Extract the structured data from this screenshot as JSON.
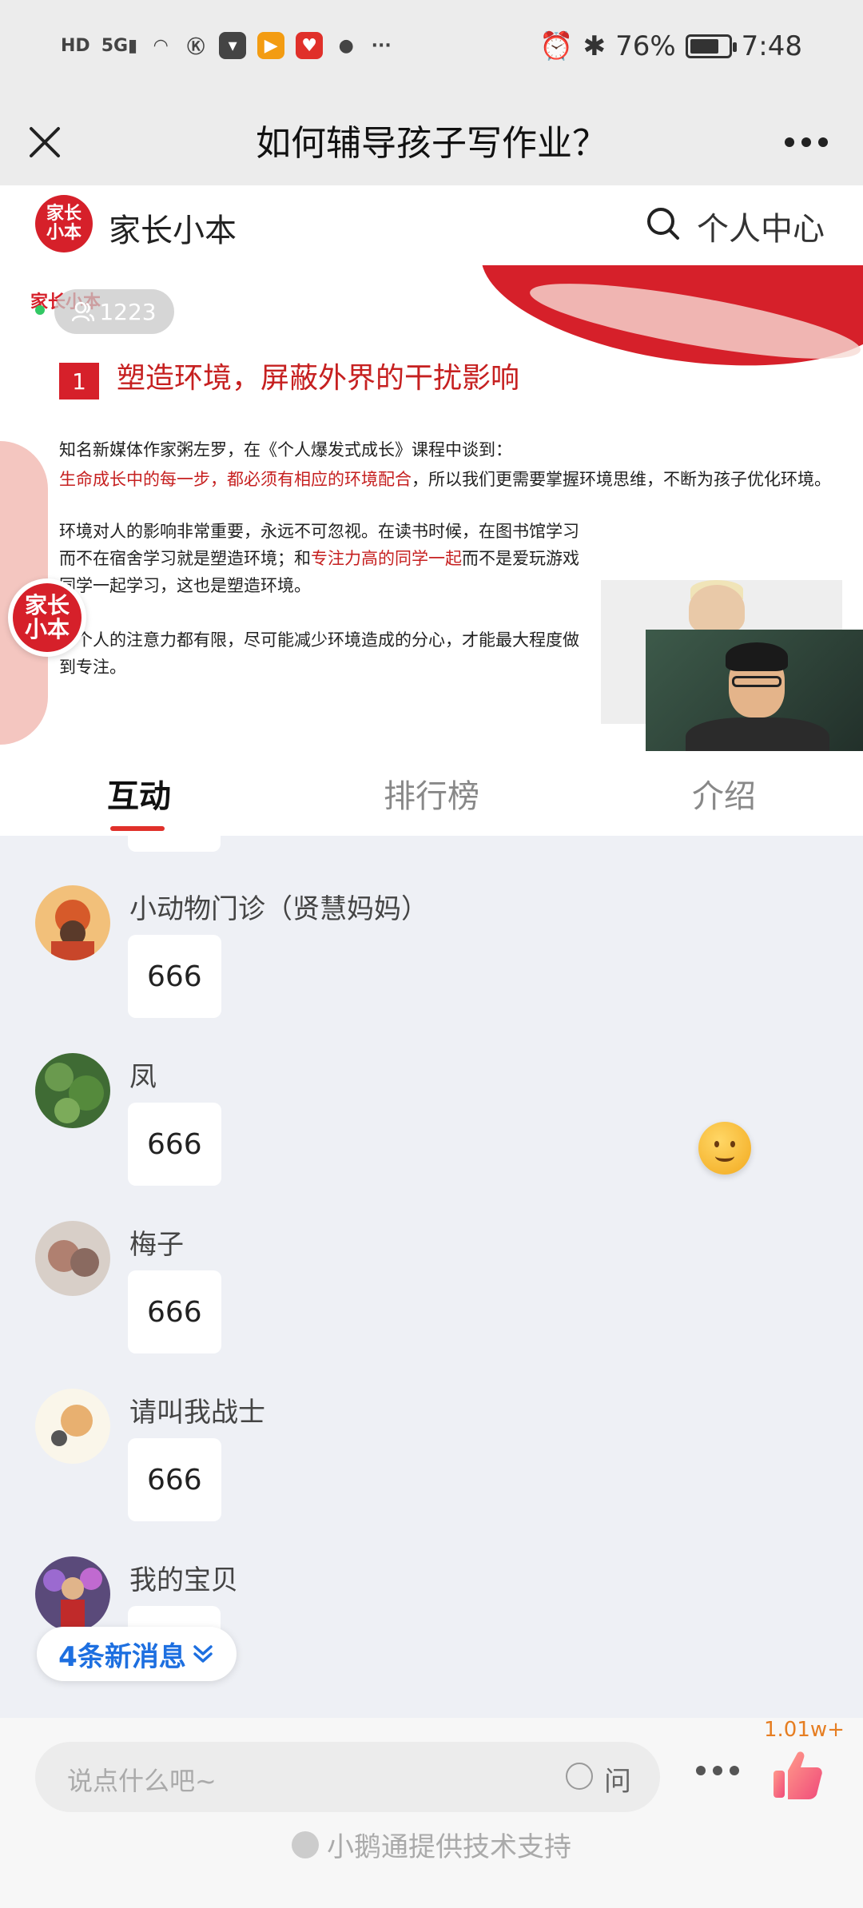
{
  "status_bar": {
    "left_icons": [
      "HD",
      "5G",
      "signal",
      "wifi",
      "K",
      "app",
      "video",
      "pinduoduo",
      "chat",
      "..."
    ],
    "battery_pct": "76%",
    "battery_level": 0.76,
    "time": "7:48"
  },
  "title_bar": {
    "title": "如何辅导孩子写作业？"
  },
  "shop": {
    "logo_text": "家长\n小本",
    "name": "家长小本",
    "profile_label": "个人中心"
  },
  "video": {
    "slide_brand": "家长小本",
    "viewers": "1223",
    "slide_number": "1",
    "slide_heading": "塑造环境，屏蔽外界的干扰影响",
    "para1_line1": "知名新媒体作家粥左罗，在《个人爆发式成长》课程中谈到：",
    "para1_red": "生命成长中的每一步，都必须有相应的环境配合",
    "para1_rest": "，所以我们更需要掌握环境思维，不断为孩子优化环境。",
    "para2_a": "环境对人的影响非常重要，永远不可忽视。在读书时候，在图书馆学习而不在宿舍学习就是塑造环境；和",
    "para2_red": "专注力高的同学一起",
    "para2_b": "而不是爱玩游戏同学一起学习，这也是塑造环境。",
    "para3": "每个人的注意力都有限，尽可能减少环境造成的分心，才能最大程度做到专注。"
  },
  "tabs": [
    {
      "label": "互动",
      "active": true
    },
    {
      "label": "排行榜",
      "active": false
    },
    {
      "label": "介绍",
      "active": false
    }
  ],
  "messages": [
    {
      "name": "小动物门诊（贤慧妈妈）",
      "text": "666",
      "avatar_color": "#d65a2a"
    },
    {
      "name": "凤",
      "text": "666",
      "avatar_color": "#4f7a3c"
    },
    {
      "name": "梅子",
      "text": "666",
      "avatar_color": "#b79c8e"
    },
    {
      "name": "请叫我战士",
      "text": "666",
      "avatar_color": "#e9d9a8"
    },
    {
      "name": "我的宝贝",
      "text": "",
      "avatar_color": "#7a5aa0"
    }
  ],
  "new_messages": "4条新消息",
  "bottom": {
    "placeholder": "说点什么吧~",
    "ask_label": "问",
    "like_count": "1.01w+",
    "powered_by": "小鹅通提供技术支持"
  },
  "colors": {
    "brand_red": "#d6202a",
    "link_blue": "#1d6fe0",
    "like_orange": "#e67e22"
  }
}
